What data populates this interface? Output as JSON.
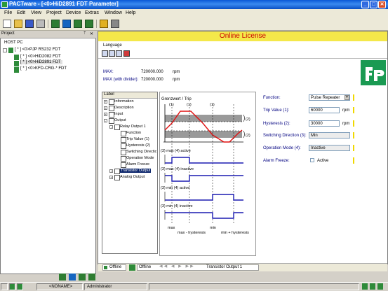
{
  "window": {
    "title": "PACTware - [<0>HiD2891 FDT Parameter]",
    "min": "_",
    "max": "□",
    "close": "✕"
  },
  "menu": [
    "File",
    "Edit",
    "View",
    "Project",
    "Device",
    "Extras",
    "Window",
    "Help"
  ],
  "project": {
    "header": "Project",
    "pin": "ᛘ",
    "close": "✕",
    "items": [
      "HOST PC",
      "[ * ] <0>PJP RS232 FDT",
      "[ * ] <0>HiD2082 FDT",
      "[ * ] <0>HiD2891 FDT",
      "[ * ] <0>KFD-CRG-* FDT"
    ]
  },
  "dtm": {
    "banner": "Online License",
    "language": "Language",
    "max_label": "MAX:",
    "max_value": "720000.000",
    "max_unit": "rpm",
    "maxdiv_label": "MAX (with divider):",
    "maxdiv_value": "720000.000",
    "maxdiv_unit": "rpm",
    "logo": "fp"
  },
  "tree": {
    "header": "Label",
    "items": [
      "Information",
      "Description",
      "Input",
      "Output",
      "Relay Output 1",
      "Function",
      "Trip Value (1)",
      "Hysteresis (2)",
      "Switching Direction",
      "Operation Mode",
      "Alarm Freeze",
      "Transistor Output",
      "Analog Output"
    ]
  },
  "diagram": {
    "title": "Grenzwert / Trip",
    "m1a": "(1)",
    "m1b": "(1)",
    "m1c": "(1)",
    "m2a": "(2)",
    "m2b": "(2)",
    "s1": "(3) max   (4) active",
    "s2": "(3) max   (4) inactive",
    "s3": "(3) min   (4) active",
    "s4": "(3) min   (4) inactive",
    "axis_max": "max",
    "axis_min": "min",
    "axis_max_h": "max - hysteresis",
    "axis_min_h": "min + hysteresis"
  },
  "params": {
    "function_label": "Function:",
    "function_value": "Pulse Repeater",
    "trip_label": "Trip Value (1):",
    "trip_value": "60000",
    "trip_unit": "rpm",
    "hyst_label": "Hysteresis (2):",
    "hyst_value": "30000",
    "hyst_unit": "rpm",
    "sw_label": "Switching Direction (3):",
    "sw_value": "Min",
    "op_label": "Operation Mode (4):",
    "op_value": "Inactive",
    "alarm_label": "Alarm Freeze:",
    "alarm_value": "Active"
  },
  "bottom_tabs": {
    "offline_tab": "Offline",
    "status_text": "Offline",
    "breadcrumb": "Transistor Output 1"
  },
  "status": {
    "user": "<NONAME>",
    "role": "Administrator"
  }
}
